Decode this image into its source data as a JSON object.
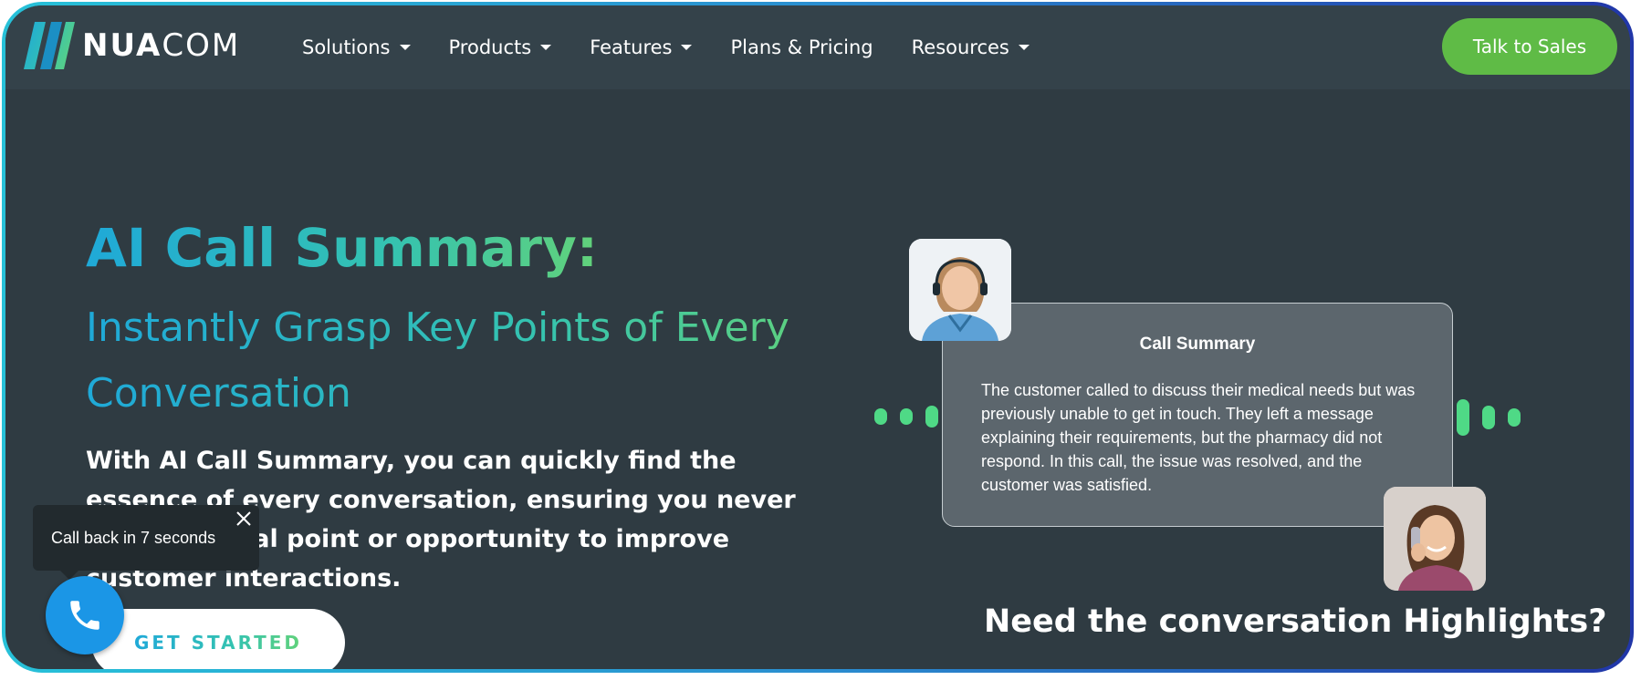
{
  "nav": {
    "logo_text_bold": "NUA",
    "logo_text_thin": "COM",
    "items": [
      {
        "label": "Solutions",
        "has_dropdown": true
      },
      {
        "label": "Products",
        "has_dropdown": true
      },
      {
        "label": "Features",
        "has_dropdown": true
      },
      {
        "label": "Plans & Pricing",
        "has_dropdown": false
      },
      {
        "label": "Resources",
        "has_dropdown": true
      }
    ],
    "cta_label": "Talk to Sales"
  },
  "hero": {
    "title": "AI Call Summary:",
    "subtitle": "Instantly Grasp Key Points of Every Conversation",
    "description": "With AI Call Summary, you can quickly find the essence of every conversation, ensuring you never miss a critical point or opportunity to improve customer interactions.",
    "cta_label": "GET STARTED"
  },
  "callback_widget": {
    "tooltip_text": "Call back in 7 seconds"
  },
  "illustration": {
    "card_title": "Call Summary",
    "card_body": "The customer called  to discuss their medical needs but was previously unable to get in touch. They left a message explaining their requirements, but the pharmacy did not respond. In this call, the issue was resolved, and the customer was satisfied.",
    "highlights_text": "Need the conversation Highlights?"
  },
  "colors": {
    "accent_green": "#5fbb46",
    "call_blue": "#1b96e6",
    "wave_green": "#4fd986",
    "background": "#2f3b42"
  }
}
